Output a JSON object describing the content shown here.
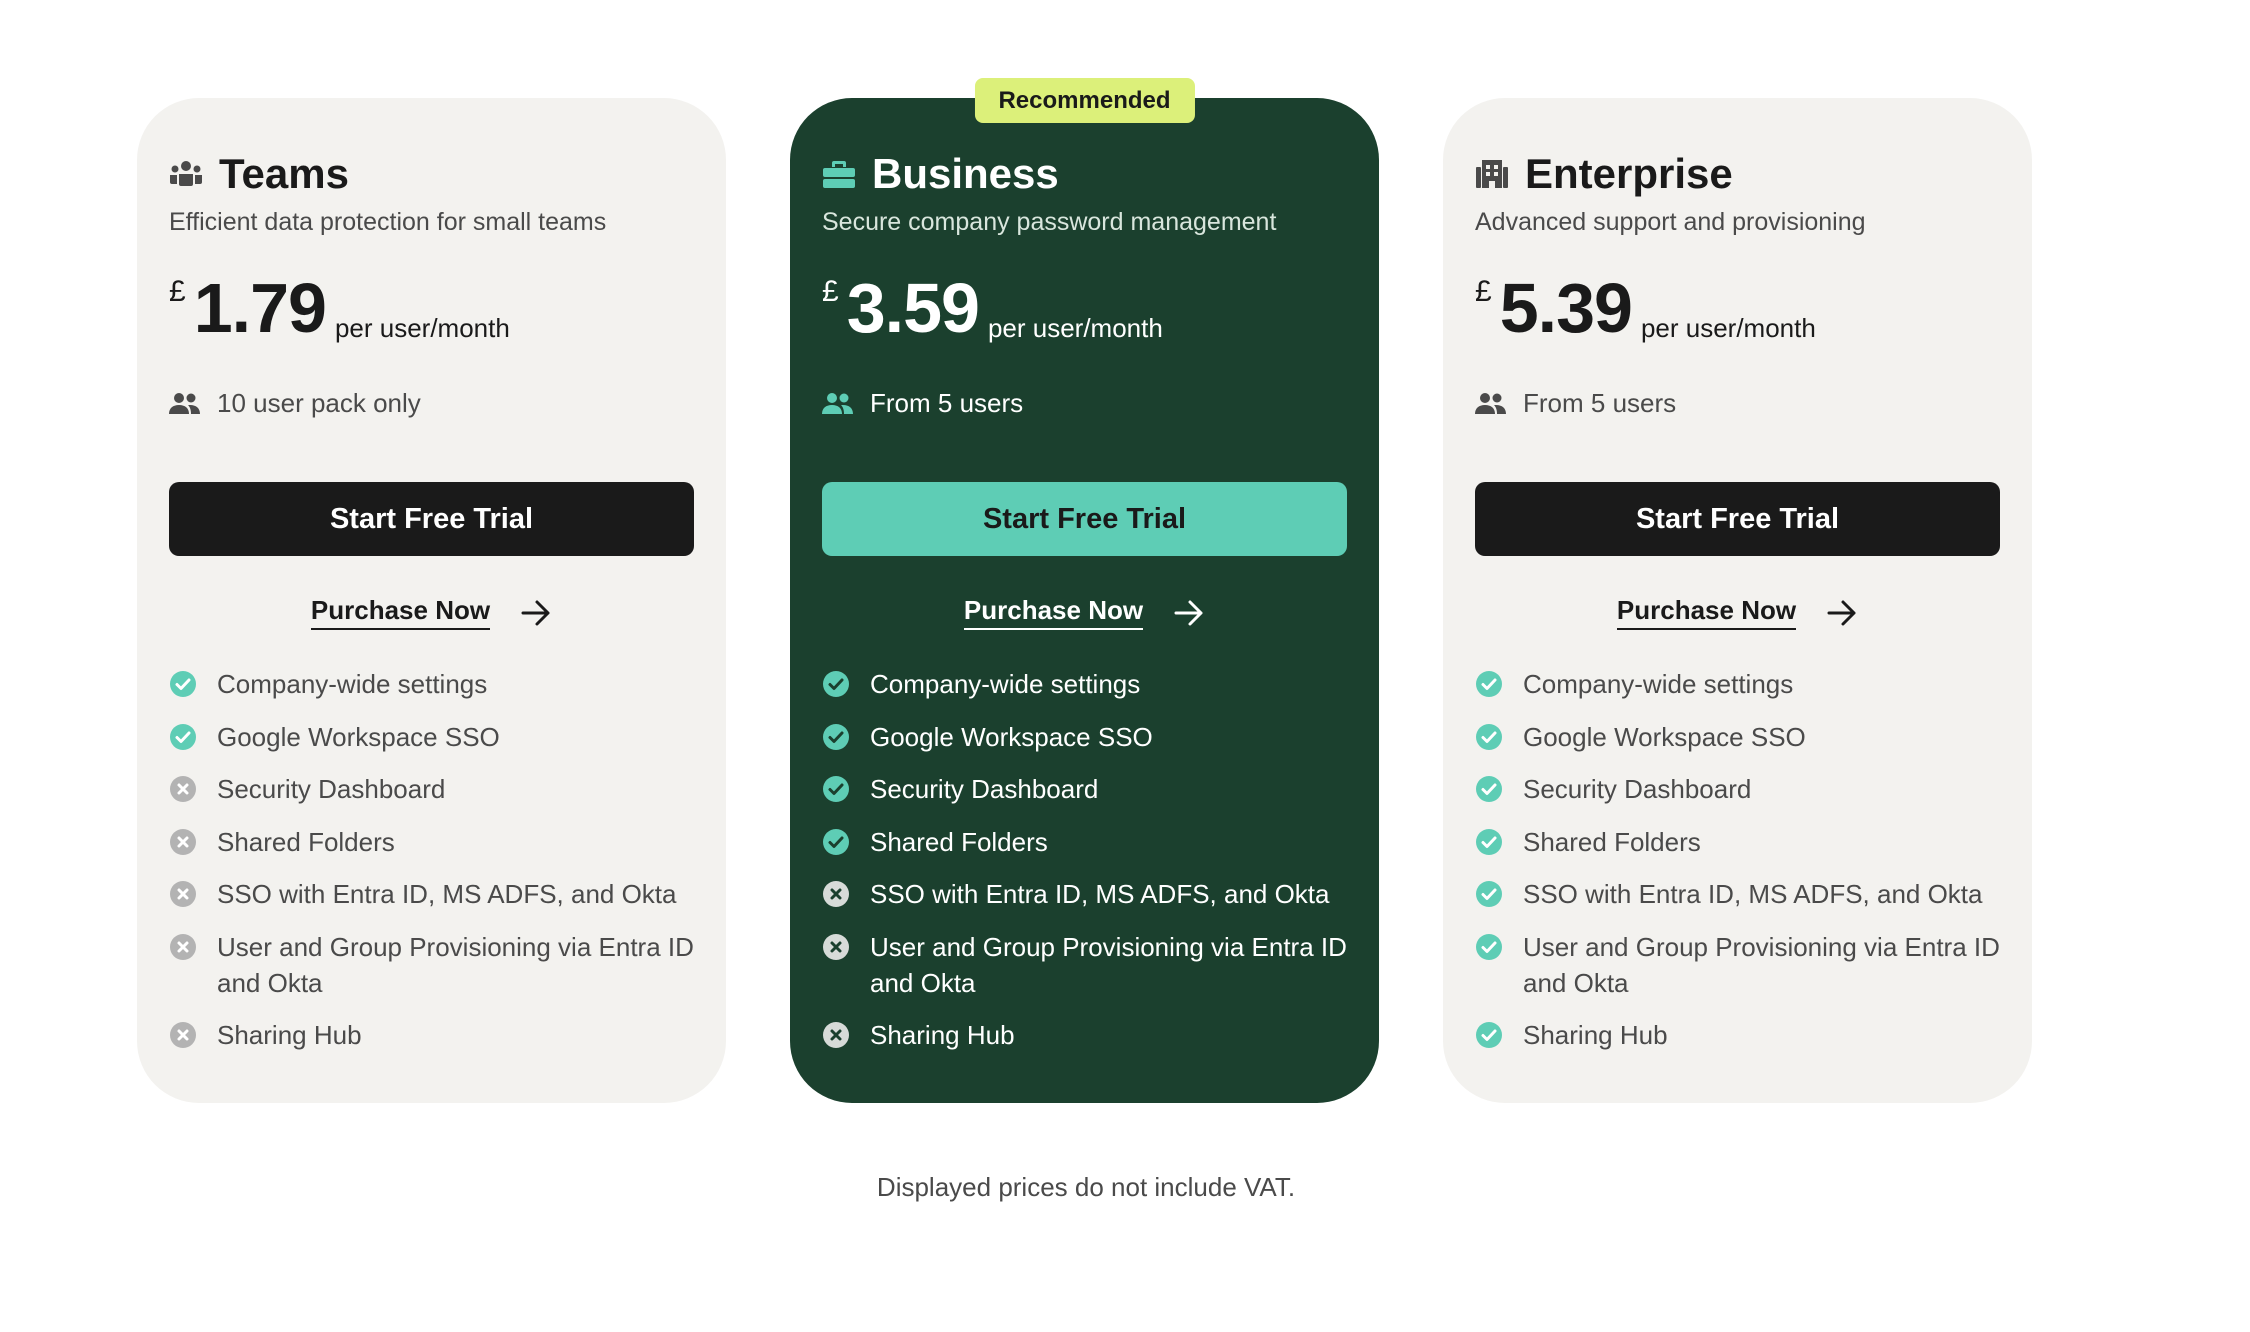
{
  "colors": {
    "featured_bg": "#1b402e",
    "card_bg": "#f3f2ef",
    "badge_bg": "#dcf07a",
    "accent": "#5ecdb5",
    "dark_button": "#1a1a1a"
  },
  "plans": [
    {
      "name": "Teams",
      "icon": "team-icon",
      "tagline": "Efficient data protection for small teams",
      "currency": "£",
      "price": "1.79",
      "period": "per user/month",
      "users_icon": "users-icon",
      "users": "10 user pack only",
      "trial_label": "Start Free Trial",
      "purchase_label": "Purchase Now",
      "features": [
        {
          "label": "Company-wide settings",
          "included": true
        },
        {
          "label": "Google Workspace SSO",
          "included": true
        },
        {
          "label": "Security Dashboard",
          "included": false
        },
        {
          "label": "Shared Folders",
          "included": false
        },
        {
          "label": "SSO with Entra ID, MS ADFS, and Okta",
          "included": false
        },
        {
          "label": "User and Group Provisioning via Entra ID and Okta",
          "included": false
        },
        {
          "label": "Sharing Hub",
          "included": false
        }
      ]
    },
    {
      "name": "Business",
      "icon": "briefcase-icon",
      "badge": "Recommended",
      "tagline": "Secure company password management",
      "currency": "£",
      "price": "3.59",
      "period": "per user/month",
      "users_icon": "users-icon",
      "users": "From 5 users",
      "trial_label": "Start Free Trial",
      "purchase_label": "Purchase Now",
      "features": [
        {
          "label": "Company-wide settings",
          "included": true
        },
        {
          "label": "Google Workspace SSO",
          "included": true
        },
        {
          "label": "Security Dashboard",
          "included": true
        },
        {
          "label": "Shared Folders",
          "included": true
        },
        {
          "label": "SSO with Entra ID, MS ADFS, and Okta",
          "included": false
        },
        {
          "label": "User and Group Provisioning via Entra ID and Okta",
          "included": false
        },
        {
          "label": "Sharing Hub",
          "included": false
        }
      ]
    },
    {
      "name": "Enterprise",
      "icon": "building-icon",
      "tagline": "Advanced support and provisioning",
      "currency": "£",
      "price": "5.39",
      "period": "per user/month",
      "users_icon": "users-icon",
      "users": "From 5 users",
      "trial_label": "Start Free Trial",
      "purchase_label": "Purchase Now",
      "features": [
        {
          "label": "Company-wide settings",
          "included": true
        },
        {
          "label": "Google Workspace SSO",
          "included": true
        },
        {
          "label": "Security Dashboard",
          "included": true
        },
        {
          "label": "Shared Folders",
          "included": true
        },
        {
          "label": "SSO with Entra ID, MS ADFS, and Okta",
          "included": true
        },
        {
          "label": "User and Group Provisioning via Entra ID and Okta",
          "included": true
        },
        {
          "label": "Sharing Hub",
          "included": true
        }
      ]
    }
  ],
  "footer_note": "Displayed prices do not include VAT."
}
